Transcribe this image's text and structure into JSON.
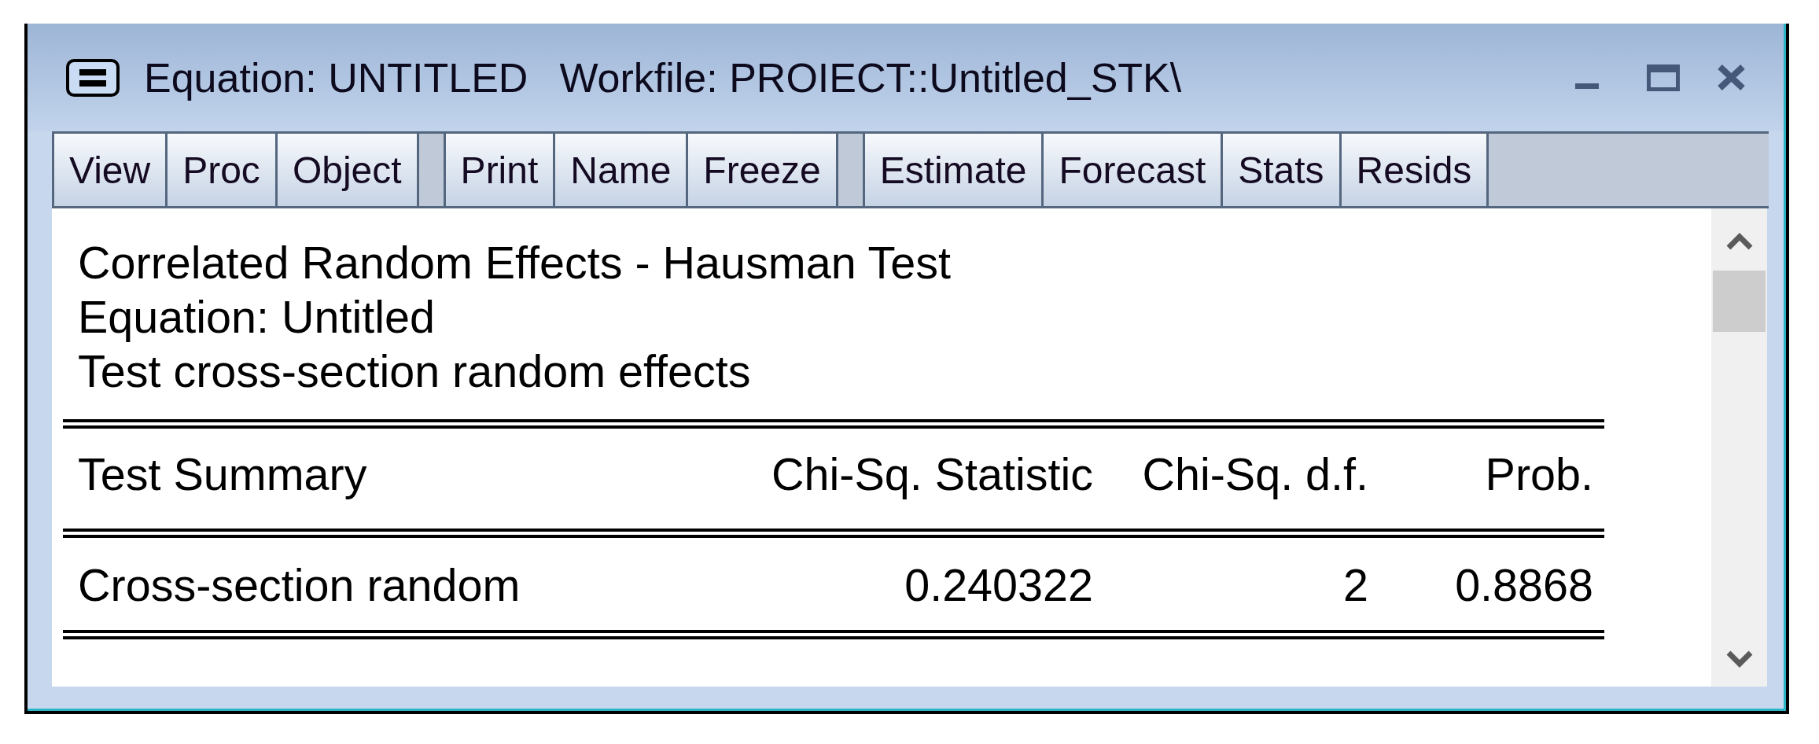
{
  "window": {
    "title": "Equation: UNTITLED",
    "workfile": "Workfile: PROIECT::Untitled_STK\\"
  },
  "toolbar": {
    "groups": [
      [
        "View",
        "Proc",
        "Object"
      ],
      [
        "Print",
        "Name",
        "Freeze"
      ],
      [
        "Estimate",
        "Forecast",
        "Stats",
        "Resids"
      ]
    ]
  },
  "output": {
    "lines": [
      "Correlated Random Effects - Hausman Test",
      "Equation: Untitled",
      "Test cross-section random effects"
    ],
    "table": {
      "columns": [
        "Test Summary",
        "Chi-Sq. Statistic",
        "Chi-Sq. d.f.",
        "Prob."
      ],
      "rows": [
        [
          "Cross-section random",
          "0.240322",
          "2",
          "0.8868"
        ]
      ]
    }
  }
}
